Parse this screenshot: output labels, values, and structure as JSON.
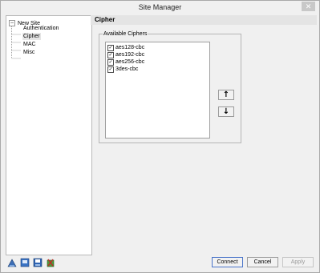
{
  "window": {
    "title": "Site Manager",
    "close_glyph": "✕"
  },
  "tree": {
    "root": {
      "expander": "−",
      "label": "New Site"
    },
    "children": [
      {
        "label": "Authentication",
        "selected": false
      },
      {
        "label": "Cipher",
        "selected": true
      },
      {
        "label": "MAC",
        "selected": false
      },
      {
        "label": "Misc",
        "selected": false
      }
    ]
  },
  "panel": {
    "title": "Cipher",
    "group_label": "Available Ciphers",
    "ciphers": [
      {
        "label": "aes128-cbc",
        "checked": true
      },
      {
        "label": "aes192-cbc",
        "checked": true
      },
      {
        "label": "aes256-cbc",
        "checked": true
      },
      {
        "label": "3des-cbc",
        "checked": true
      }
    ],
    "move_up_glyph": "↑",
    "move_down_glyph": "↓"
  },
  "toolbar_icons": [
    "new-site-icon",
    "new-folder-icon",
    "save-icon",
    "delete-icon"
  ],
  "buttons": {
    "connect": "Connect",
    "cancel": "Cancel",
    "apply": "Apply",
    "apply_enabled": false
  },
  "colors": {
    "window_bg": "#f0f0f0",
    "header_bg": "#e4e4e4",
    "selection": "#e5e5e5",
    "primary_border": "#4a74c9"
  }
}
